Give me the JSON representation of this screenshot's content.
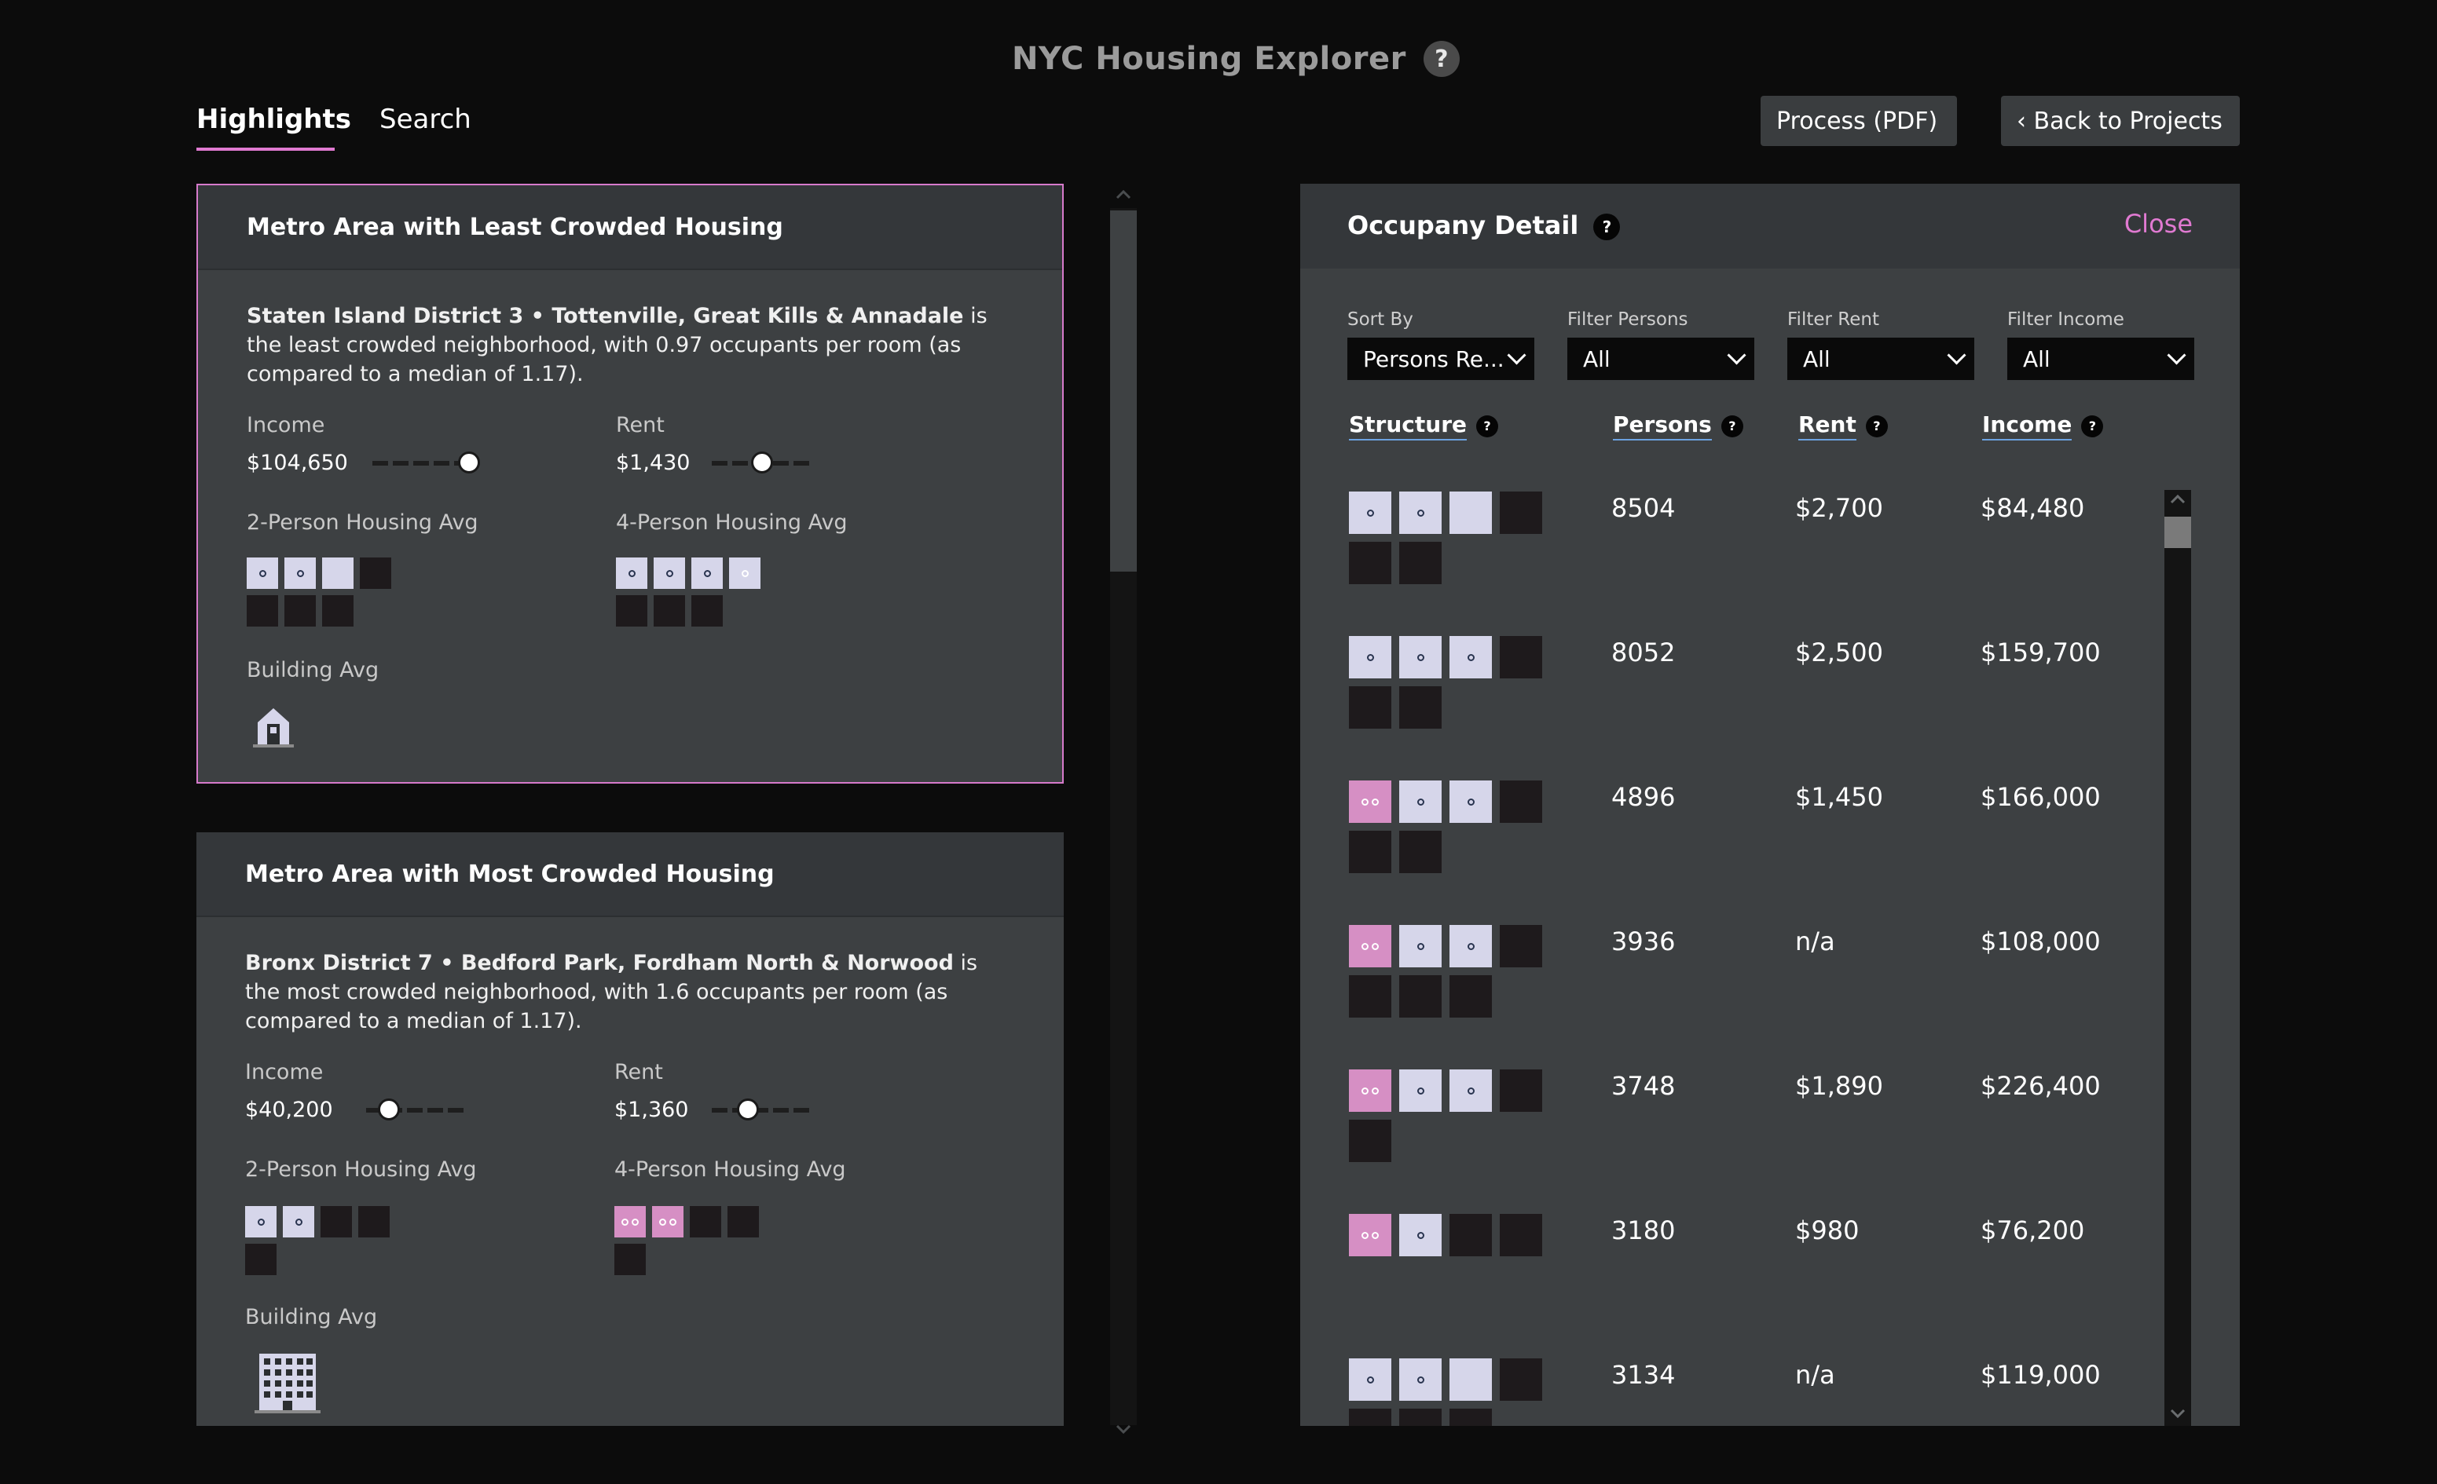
{
  "header": {
    "title": "NYC Housing Explorer",
    "help": "?"
  },
  "tabs": [
    {
      "label": "Highlights"
    },
    {
      "label": "Search"
    }
  ],
  "actions": {
    "process": "Process (PDF)",
    "back": "‹ Back to Projects"
  },
  "least": {
    "heading": "Metro Area with Least Crowded Housing",
    "area": "Staten Island District 3 • Tottenville, Great Kills & Annadale",
    "text": " is the least crowded neighborhood, with 0.97 occupants per room (as compared to a median of 1.17).",
    "income_label": "Income",
    "income": "$104,650",
    "income_level": 1.0,
    "rent_label": "Rent",
    "rent": "$1,430",
    "rent_level": 0.45,
    "two_label": "2-Person Housing Avg",
    "four_label": "4-Person Housing Avg",
    "building_label": "Building Avg",
    "building_icon": "house-icon"
  },
  "most": {
    "heading": "Metro Area with Most Crowded Housing",
    "area": "Bronx District 7 • Bedford Park, Fordham North & Norwood",
    "text": " is the most crowded neighborhood, with 1.6 occupants per room (as compared to a median of 1.17).",
    "income_label": "Income",
    "income": "$40,200",
    "income_level": 0.2,
    "rent_label": "Rent",
    "rent": "$1,360",
    "rent_level": 0.33,
    "two_label": "2-Person Housing Avg",
    "four_label": "4-Person Housing Avg",
    "building_label": "Building Avg",
    "building_icon": "apartment-building-icon"
  },
  "detail": {
    "title": "Occupany Detail",
    "close": "Close",
    "sort_label": "Sort By",
    "sort_value": "Persons Re...",
    "persons_label": "Filter Persons",
    "persons_value": "All",
    "rent_label": "Filter Rent",
    "rent_value": "All",
    "income_label": "Filter Income",
    "income_value": "All",
    "columns": {
      "structure": "Structure",
      "persons": "Persons",
      "rent": "Rent",
      "income": "Income"
    },
    "rows": [
      {
        "persons": "8504",
        "rent": "$2,700",
        "income": "$84,480"
      },
      {
        "persons": "8052",
        "rent": "$2,500",
        "income": "$159,700"
      },
      {
        "persons": "4896",
        "rent": "$1,450",
        "income": "$166,000"
      },
      {
        "persons": "3936",
        "rent": "n/a",
        "income": "$108,000"
      },
      {
        "persons": "3748",
        "rent": "$1,890",
        "income": "$226,400"
      },
      {
        "persons": "3180",
        "rent": "$980",
        "income": "$76,200"
      },
      {
        "persons": "3134",
        "rent": "n/a",
        "income": "$119,000"
      }
    ]
  }
}
